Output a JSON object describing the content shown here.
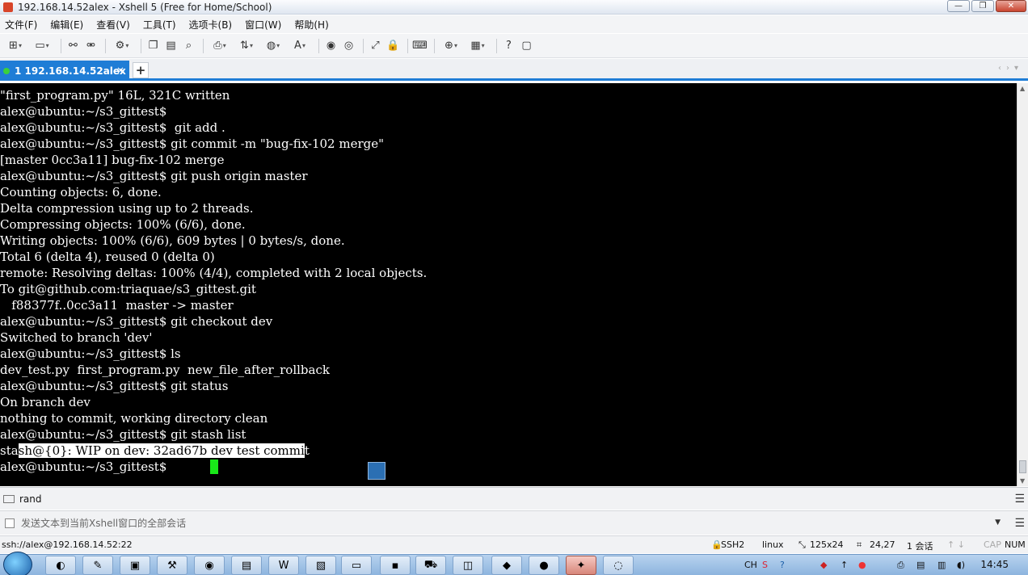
{
  "window": {
    "title": "192.168.14.52alex - Xshell 5 (Free for Home/School)",
    "controls": [
      "—",
      "❐",
      "✕"
    ]
  },
  "menu": [
    "文件(F)",
    "编辑(E)",
    "查看(V)",
    "工具(T)",
    "选项卡(B)",
    "窗口(W)",
    "帮助(H)"
  ],
  "toolbar": {
    "icons": [
      "new-session-icon",
      "open-folder-icon",
      "reconnect-icon",
      "disconnect-icon",
      "properties-icon",
      "copy-icon",
      "paste-icon",
      "find-icon",
      "print-icon",
      "transfer-icon",
      "globe-icon",
      "font-icon",
      "xftp-icon",
      "xmanager-icon",
      "fullscreen-icon",
      "lock-icon",
      "keyboard-icon",
      "new-tab-icon",
      "layout-icon",
      "help-icon",
      "chat-icon"
    ]
  },
  "tab": {
    "label": "1 192.168.14.52alex",
    "close": "×",
    "add": "+",
    "nav": "‹›▾"
  },
  "terminal": {
    "lines": [
      "\"first_program.py\" 16L, 321C written",
      "alex@ubuntu:~/s3_gittest$",
      "alex@ubuntu:~/s3_gittest$  git add .",
      "alex@ubuntu:~/s3_gittest$ git commit -m \"bug-fix-102 merge\"",
      "[master 0cc3a11] bug-fix-102 merge",
      "alex@ubuntu:~/s3_gittest$ git push origin master",
      "Counting objects: 6, done.",
      "Delta compression using up to 2 threads.",
      "Compressing objects: 100% (6/6), done.",
      "Writing objects: 100% (6/6), 609 bytes | 0 bytes/s, done.",
      "Total 6 (delta 4), reused 0 (delta 0)",
      "remote: Resolving deltas: 100% (4/4), completed with 2 local objects.",
      "To git@github.com:triaquae/s3_gittest.git",
      "   f88377f..0cc3a11  master -> master",
      "alex@ubuntu:~/s3_gittest$ git checkout dev",
      "Switched to branch 'dev'",
      "alex@ubuntu:~/s3_gittest$ ls",
      "dev_test.py  first_program.py  new_file_after_rollback",
      "alex@ubuntu:~/s3_gittest$ git status",
      "On branch dev",
      "nothing to commit, working directory clean",
      "alex@ubuntu:~/s3_gittest$ git stash list"
    ],
    "stash_prefix": "sta",
    "stash_selected": "sh@{0}: WIP on dev: 32ad67b dev test commi",
    "stash_suffix": "t",
    "prompt": "alex@ubuntu:~/s3_gittest$",
    "cursor_color": "#19e819"
  },
  "quickbar": {
    "label": "rand"
  },
  "compose": {
    "placeholder": "发送文本到当前Xshell窗口的全部会话"
  },
  "status": {
    "connection": "ssh://alex@192.168.14.52:22",
    "protocol": "SSH2",
    "os": "linux",
    "size": "125x24",
    "position": "24,27",
    "sessions": "1 会话",
    "caps": "CAP",
    "num": "NUM"
  },
  "taskbar": {
    "apps": [
      "chrome-icon",
      "explorer-icon",
      "save-icon",
      "tools-icon",
      "chrome-icon",
      "notepad-icon",
      "word-icon",
      "ppt-icon",
      "folder-icon",
      "terminal-icon",
      "shop-icon",
      "green-app-icon",
      "git-icon",
      "app-red-icon",
      "xshell-icon",
      "xftp-icon"
    ],
    "ime": "CH",
    "clock": "14:45"
  }
}
